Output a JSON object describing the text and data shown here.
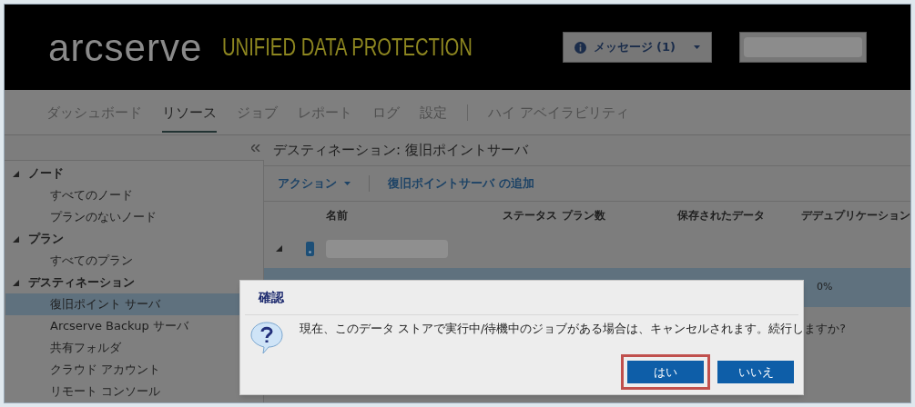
{
  "header": {
    "logo": "arcserve",
    "product": "UNIFIED DATA PROTECTION",
    "messages_button": "メッセージ (1)"
  },
  "nav_tabs": [
    {
      "label": "ダッシュボード",
      "selected": false
    },
    {
      "label": "リソース",
      "selected": true
    },
    {
      "label": "ジョブ",
      "selected": false
    },
    {
      "label": "レポート",
      "selected": false
    },
    {
      "label": "ログ",
      "selected": false
    },
    {
      "label": "設定",
      "selected": false
    },
    {
      "label": "ハイ アベイラビリティ",
      "selected": false
    }
  ],
  "sidebar": {
    "items": [
      {
        "label": "ノード",
        "expanded": true,
        "selected": false,
        "children": [
          {
            "label": "すべてのノード",
            "selected": false
          },
          {
            "label": "プランのないノード",
            "selected": false
          }
        ]
      },
      {
        "label": "プラン",
        "expanded": true,
        "selected": false,
        "children": [
          {
            "label": "すべてのプラン",
            "selected": false
          }
        ]
      },
      {
        "label": "デスティネーション",
        "expanded": true,
        "selected": false,
        "children": [
          {
            "label": "復旧ポイント サーバ",
            "selected": true
          },
          {
            "label": "Arcserve Backup サーバ",
            "selected": false
          },
          {
            "label": "共有フォルダ",
            "selected": false
          },
          {
            "label": "クラウド アカウント",
            "selected": false
          },
          {
            "label": "リモート コンソール",
            "selected": false
          }
        ]
      }
    ]
  },
  "page_title": "デスティネーション: 復旧ポイントサーバ",
  "toolbar": {
    "actions": "アクション",
    "add": "復旧ポイントサーバ の追加"
  },
  "table": {
    "columns": [
      "名前",
      "ステータス",
      "プラン数",
      "保存されたデータ",
      "デデュプリケーション"
    ],
    "rows": [
      {
        "expanded": true,
        "selected": false,
        "cells": [
          "",
          "",
          "",
          "",
          ""
        ]
      },
      {
        "selected": true,
        "cells": [
          "",
          "",
          "",
          "",
          "0%"
        ]
      }
    ]
  },
  "dialog": {
    "title": "確認",
    "message": "現在、このデータ ストアで実行中/待機中のジョブがある場合は、キャンセルされます。続行しますか?",
    "buttons": [
      {
        "label": "はい",
        "highlighted": true
      },
      {
        "label": "いいえ",
        "highlighted": false
      }
    ]
  }
}
